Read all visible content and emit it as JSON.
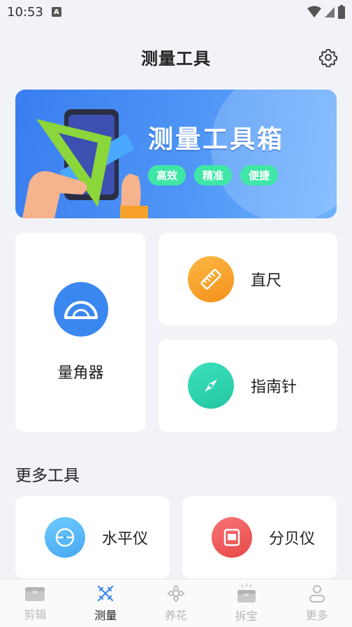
{
  "status": {
    "time": "10:53",
    "notification": "A"
  },
  "header": {
    "title": "测量工具"
  },
  "banner": {
    "title": "测量工具箱",
    "tags": [
      "高效",
      "精准",
      "便捷"
    ]
  },
  "tools": {
    "protractor": {
      "label": "量角器",
      "color": "#3b87f0"
    },
    "ruler": {
      "label": "直尺",
      "color": "#f7a22b"
    },
    "compass": {
      "label": "指南针",
      "color": "#2fd6b0"
    }
  },
  "more": {
    "title": "更多工具",
    "level": {
      "label": "水平仪",
      "color": "#5ab8f5"
    },
    "decibel": {
      "label": "分贝仪",
      "color": "#ef5b5b"
    }
  },
  "nav": {
    "items": [
      {
        "label": "剪辑",
        "icon": "toolbox-icon"
      },
      {
        "label": "测量",
        "icon": "measure-icon",
        "active": true
      },
      {
        "label": "养花",
        "icon": "flower-icon"
      },
      {
        "label": "拆宝",
        "icon": "gift-box-icon"
      },
      {
        "label": "更多",
        "icon": "profile-icon"
      }
    ]
  },
  "colors": {
    "accent": "#3b87f0",
    "background": "#f1f3f8"
  }
}
